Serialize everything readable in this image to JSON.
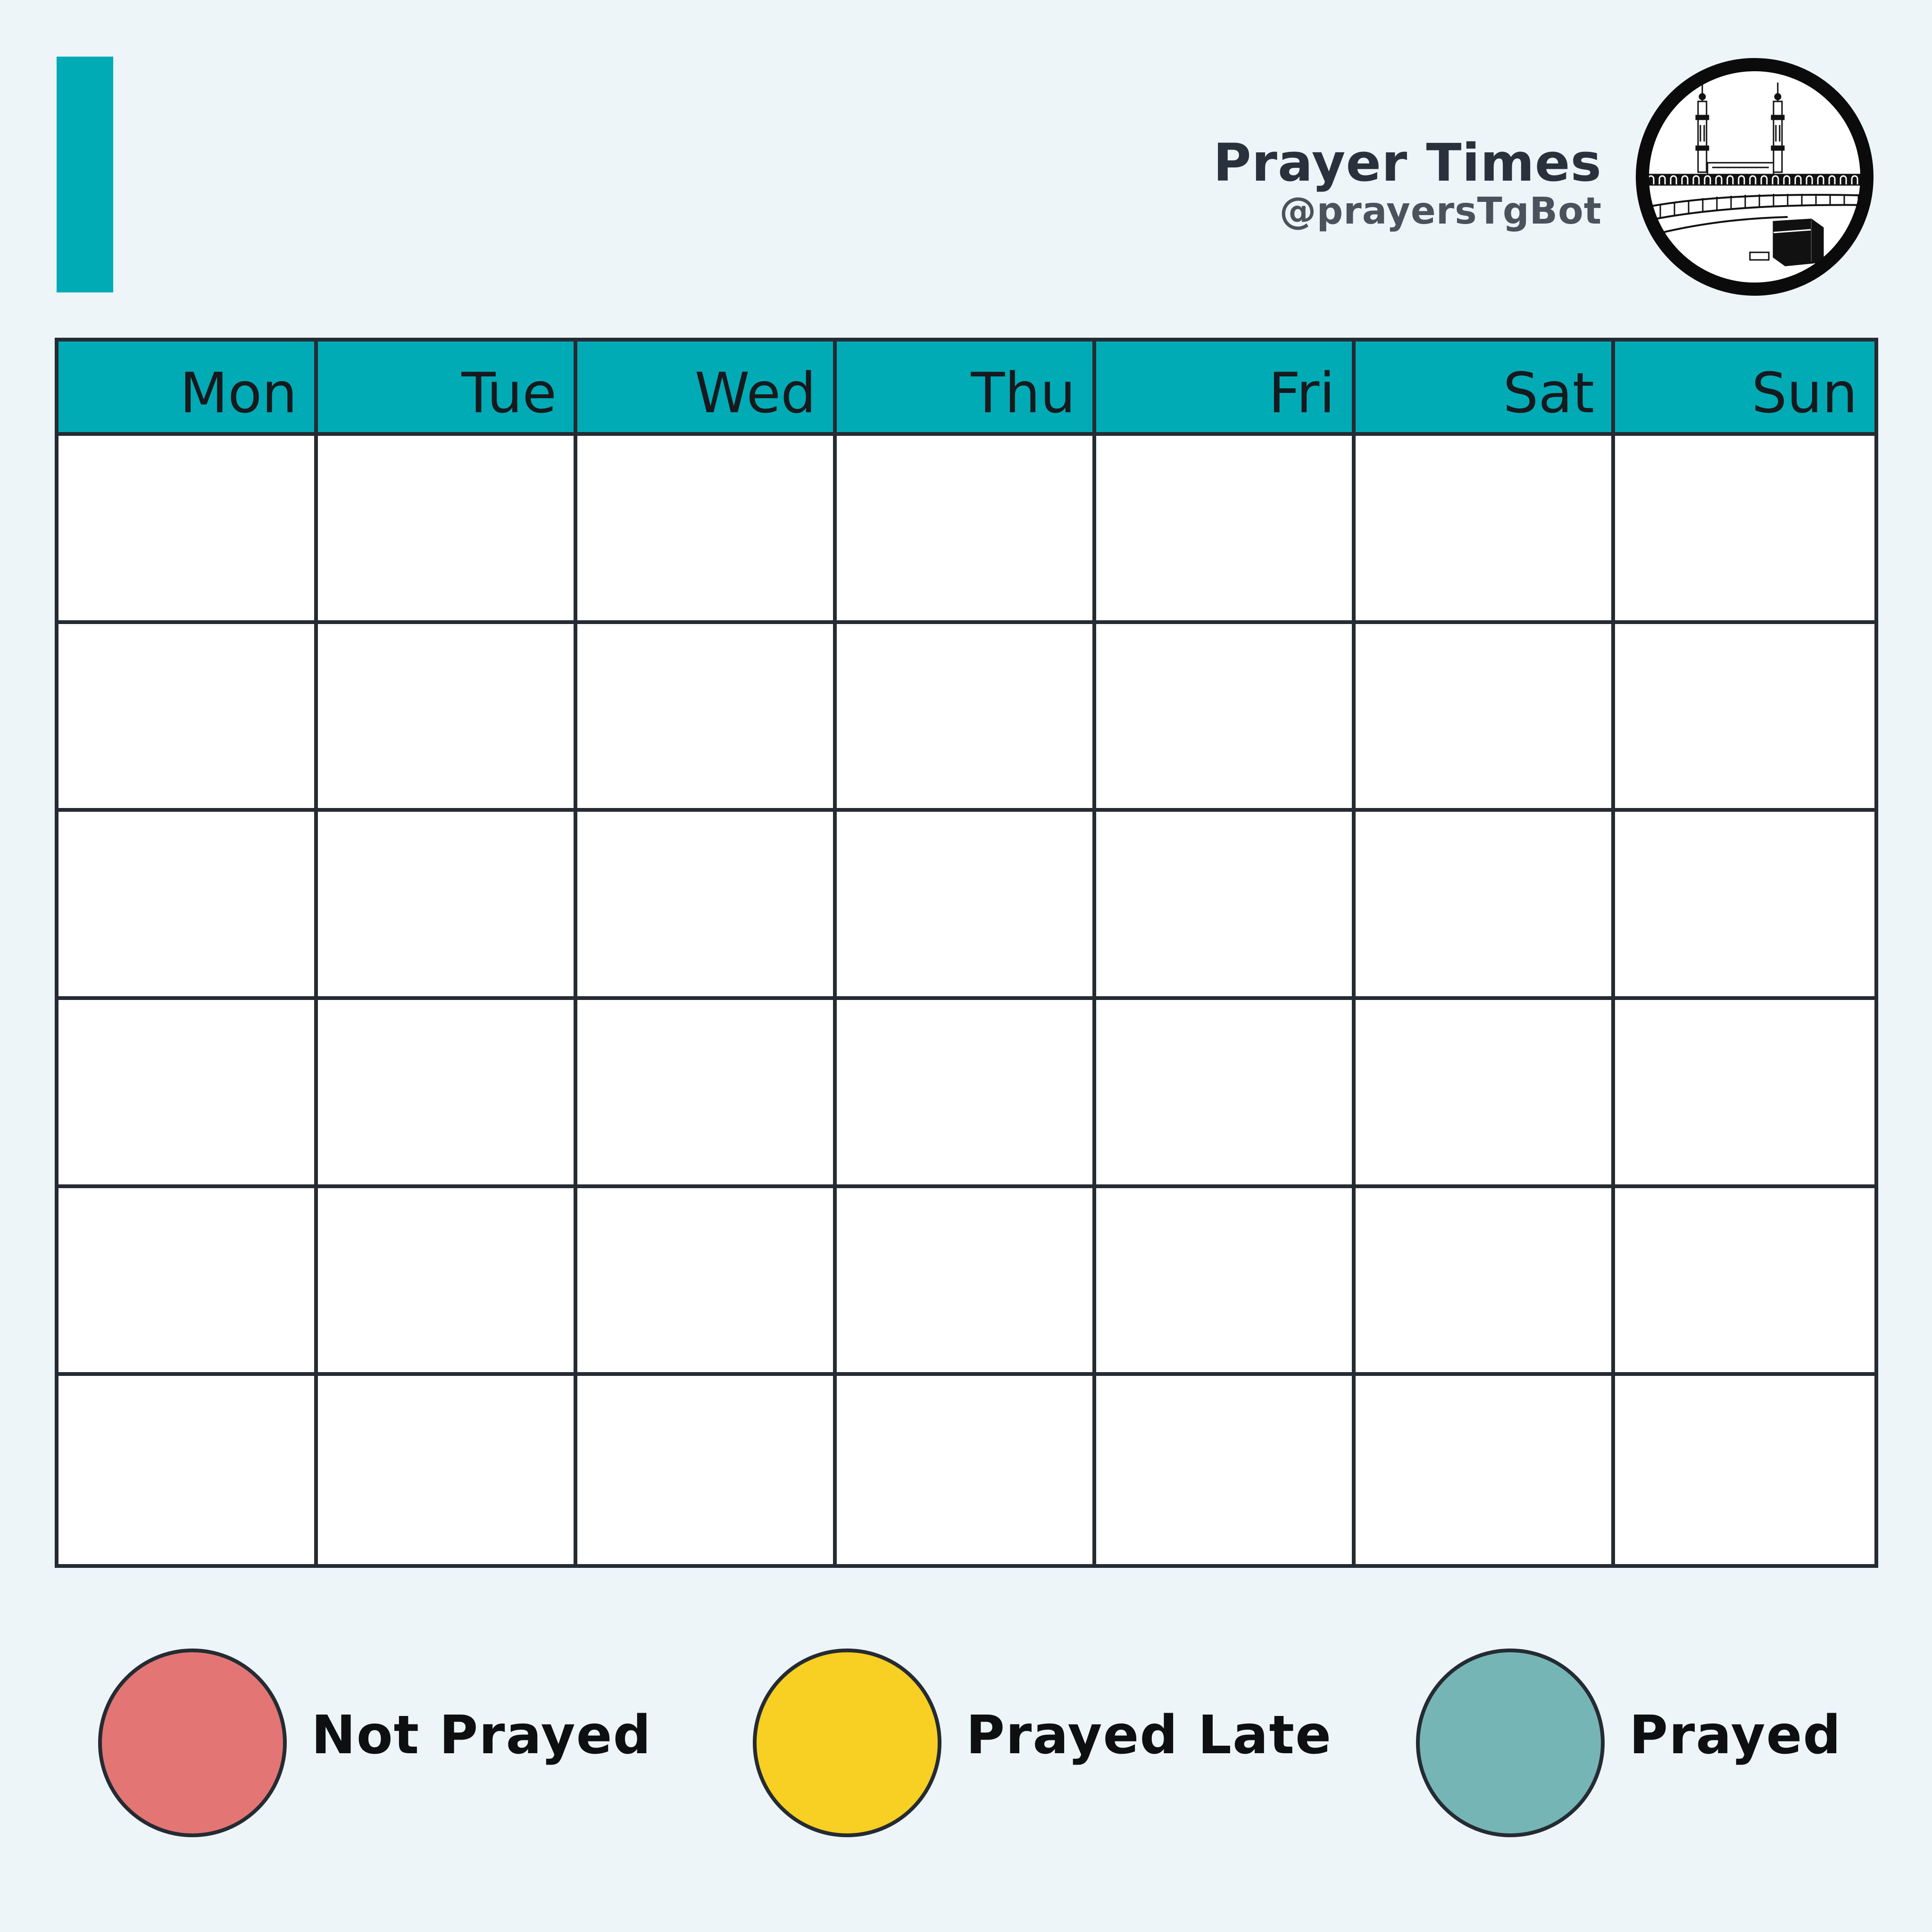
{
  "header": {
    "title": "Prayer Times",
    "handle": "@prayersTgBot",
    "accent_color": "#00abb6",
    "logo_icon": "kaaba-mosque-icon"
  },
  "calendar": {
    "days": [
      "Mon",
      "Tue",
      "Wed",
      "Thu",
      "Fri",
      "Sat",
      "Sun"
    ],
    "weeks": 6,
    "header_color": "#00abb6"
  },
  "legend": [
    {
      "label": "Not Prayed",
      "color": "#e37674"
    },
    {
      "label": "Prayed Late",
      "color": "#f8cf23"
    },
    {
      "label": "Prayed",
      "color": "#76b5b6"
    }
  ]
}
